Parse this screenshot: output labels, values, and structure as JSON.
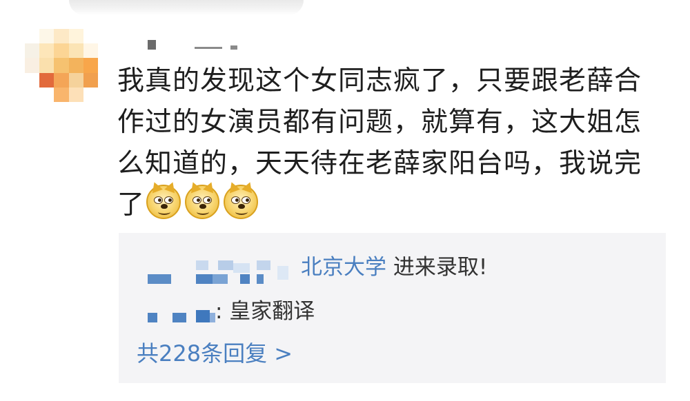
{
  "comment": {
    "text": "我真的发现这个女同志疯了，只要跟老薛合作过的女演员都有问题，就算有，这大姐怎么知道的，天天待在老薛家阳台吗，我说完了",
    "emoji_icons": [
      "doge-emoji",
      "doge-emoji",
      "doge-emoji"
    ]
  },
  "replies": [
    {
      "name_visible": "北京大学",
      "text": " 进来录取!"
    },
    {
      "name_visible": ":",
      "text": " 皇家翻译"
    }
  ],
  "more_replies": "共228条回复 >",
  "colors": {
    "link": "#4a7fc0",
    "reply_bg": "#f4f4f6",
    "text": "#1e1e1e"
  }
}
